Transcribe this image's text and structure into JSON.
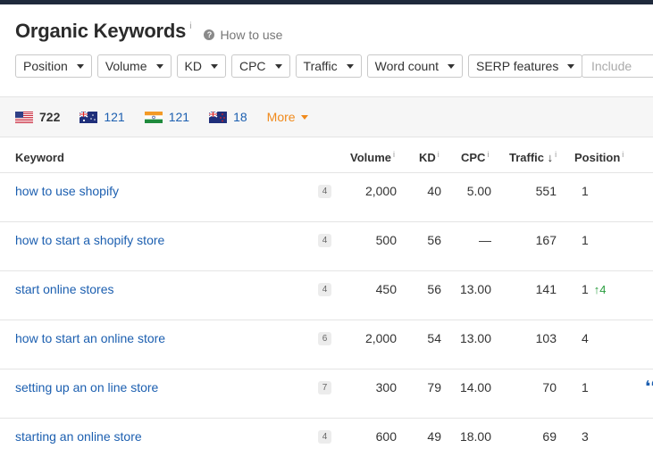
{
  "header": {
    "title": "Organic Keywords",
    "title_info": "i",
    "how_to_use": "How to use",
    "help_icon_glyph": "?"
  },
  "filters": [
    {
      "label": "Position"
    },
    {
      "label": "Volume"
    },
    {
      "label": "KD"
    },
    {
      "label": "CPC"
    },
    {
      "label": "Traffic"
    },
    {
      "label": "Word count"
    },
    {
      "label": "SERP features"
    }
  ],
  "include": {
    "placeholder": "Include"
  },
  "countries": [
    {
      "flag": "us",
      "count": "722"
    },
    {
      "flag": "au",
      "count": "121"
    },
    {
      "flag": "in",
      "count": "121"
    },
    {
      "flag": "nz",
      "count": "18"
    }
  ],
  "more_label": "More",
  "columns": {
    "keyword": "Keyword",
    "volume": "Volume",
    "kd": "KD",
    "cpc": "CPC",
    "traffic": "Traffic",
    "traffic_sort": "↓",
    "position": "Position",
    "info": "i"
  },
  "rows": [
    {
      "keyword": "how to use shopify",
      "words": "4",
      "volume": "2,000",
      "kd": "40",
      "cpc": "5.00",
      "traffic": "551",
      "position": "1",
      "change": ""
    },
    {
      "keyword": "how to start a shopify store",
      "words": "4",
      "volume": "500",
      "kd": "56",
      "cpc": "—",
      "traffic": "167",
      "position": "1",
      "change": ""
    },
    {
      "keyword": "start online stores",
      "words": "4",
      "volume": "450",
      "kd": "56",
      "cpc": "13.00",
      "traffic": "141",
      "position": "1",
      "change": "↑4"
    },
    {
      "keyword": "how to start an online store",
      "words": "6",
      "volume": "2,000",
      "kd": "54",
      "cpc": "13.00",
      "traffic": "103",
      "position": "4",
      "change": ""
    },
    {
      "keyword": "setting up an on line store",
      "words": "7",
      "volume": "300",
      "kd": "79",
      "cpc": "14.00",
      "traffic": "70",
      "position": "1",
      "change": "",
      "serp_icon": "❛❛"
    },
    {
      "keyword": "starting an online store",
      "words": "4",
      "volume": "600",
      "kd": "49",
      "cpc": "18.00",
      "traffic": "69",
      "position": "3",
      "change": ""
    }
  ],
  "colors": {
    "link": "#1c5fb0",
    "accent_orange": "#f08a1c",
    "positive": "#2a9d3f",
    "topbar": "#1f2a3c"
  }
}
